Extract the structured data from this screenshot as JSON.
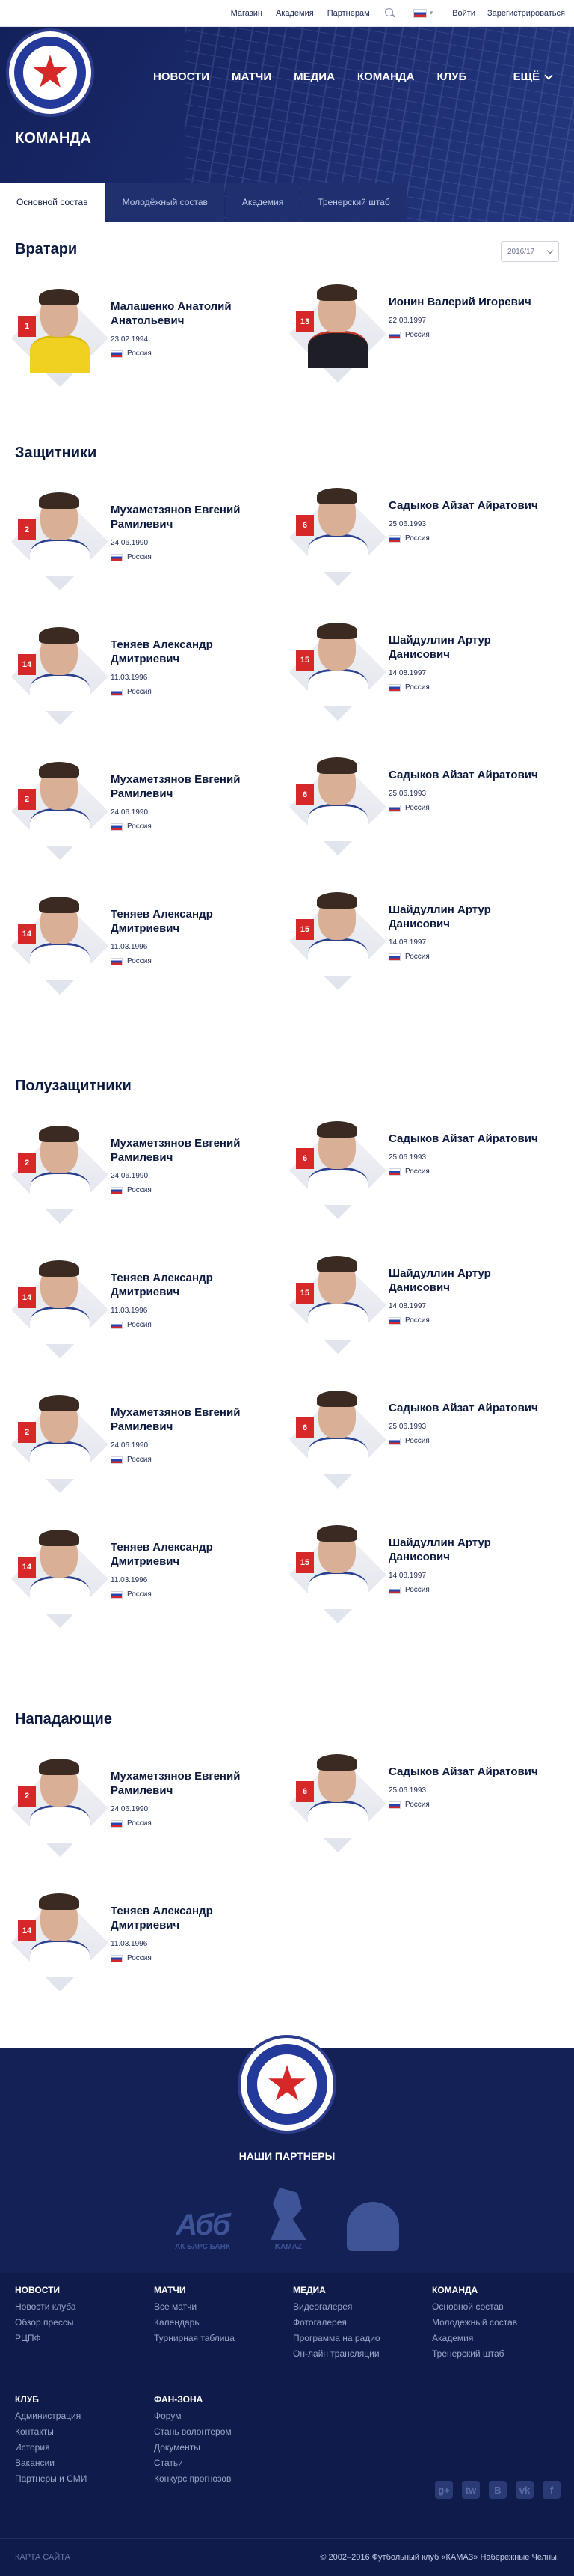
{
  "topbar": {
    "links": [
      "Магазин",
      "Академия",
      "Партнерам"
    ],
    "login": "Войти",
    "register": "Зарегистрироваться"
  },
  "nav": {
    "items": [
      "Новости",
      "Матчи",
      "Медиа",
      "Команда",
      "Клуб"
    ],
    "more": "Ещё"
  },
  "page": {
    "title": "Команда",
    "tabs": [
      "Основной состав",
      "Молодёжный состав",
      "Академия",
      "Тренерский штаб"
    ],
    "season": "2016/17"
  },
  "sections": [
    {
      "title": "Вратари",
      "players": [
        {
          "number": "1",
          "name": "Малашенко Анатолий Анатольевич",
          "birth": "23.02.1994",
          "country": "Россия",
          "kit": "gk"
        },
        {
          "number": "13",
          "name": "Ионин Валерий Игоревич",
          "birth": "22.08.1997",
          "country": "Россия",
          "kit": "dark"
        }
      ]
    },
    {
      "title": "Защитники",
      "players": [
        {
          "number": "2",
          "name": "Мухаметзянов Евгений Рамилевич",
          "birth": "24.06.1990",
          "country": "Россия",
          "kit": "home"
        },
        {
          "number": "6",
          "name": "Садыков Айзат Айратович",
          "birth": "25.06.1993",
          "country": "Россия",
          "kit": "home"
        },
        {
          "number": "14",
          "name": "Теняев Александр Дмитриевич",
          "birth": "11.03.1996",
          "country": "Россия",
          "kit": "home"
        },
        {
          "number": "15",
          "name": "Шайдуллин Артур Данисович",
          "birth": "14.08.1997",
          "country": "Россия",
          "kit": "home"
        },
        {
          "number": "2",
          "name": "Мухаметзянов Евгений Рамилевич",
          "birth": "24.06.1990",
          "country": "Россия",
          "kit": "home"
        },
        {
          "number": "6",
          "name": "Садыков Айзат Айратович",
          "birth": "25.06.1993",
          "country": "Россия",
          "kit": "home"
        },
        {
          "number": "14",
          "name": "Теняев Александр Дмитриевич",
          "birth": "11.03.1996",
          "country": "Россия",
          "kit": "home"
        },
        {
          "number": "15",
          "name": "Шайдуллин Артур Данисович",
          "birth": "14.08.1997",
          "country": "Россия",
          "kit": "home"
        }
      ]
    },
    {
      "title": "Полузащитники",
      "players": [
        {
          "number": "2",
          "name": "Мухаметзянов Евгений Рамилевич",
          "birth": "24.06.1990",
          "country": "Россия",
          "kit": "home"
        },
        {
          "number": "6",
          "name": "Садыков Айзат Айратович",
          "birth": "25.06.1993",
          "country": "Россия",
          "kit": "home"
        },
        {
          "number": "14",
          "name": "Теняев Александр Дмитриевич",
          "birth": "11.03.1996",
          "country": "Россия",
          "kit": "home"
        },
        {
          "number": "15",
          "name": "Шайдуллин Артур Данисович",
          "birth": "14.08.1997",
          "country": "Россия",
          "kit": "home"
        },
        {
          "number": "2",
          "name": "Мухаметзянов Евгений Рамилевич",
          "birth": "24.06.1990",
          "country": "Россия",
          "kit": "home"
        },
        {
          "number": "6",
          "name": "Садыков Айзат Айратович",
          "birth": "25.06.1993",
          "country": "Россия",
          "kit": "home"
        },
        {
          "number": "14",
          "name": "Теняев Александр Дмитриевич",
          "birth": "11.03.1996",
          "country": "Россия",
          "kit": "home"
        },
        {
          "number": "15",
          "name": "Шайдуллин Артур Данисович",
          "birth": "14.08.1997",
          "country": "Россия",
          "kit": "home"
        }
      ]
    },
    {
      "title": "Нападающие",
      "players": [
        {
          "number": "2",
          "name": "Мухаметзянов Евгений Рамилевич",
          "birth": "24.06.1990",
          "country": "Россия",
          "kit": "home"
        },
        {
          "number": "6",
          "name": "Садыков Айзат Айратович",
          "birth": "25.06.1993",
          "country": "Россия",
          "kit": "home"
        },
        {
          "number": "14",
          "name": "Теняев Александр Дмитриевич",
          "birth": "11.03.1996",
          "country": "Россия",
          "kit": "home"
        }
      ]
    }
  ],
  "partners": {
    "title": "Наши партнеры",
    "logos": [
      {
        "mark": "Абб",
        "caption": "АК БАРС БАНК"
      },
      {
        "mark": "",
        "caption": "KAMAZ"
      },
      {
        "mark": "",
        "caption": ""
      }
    ]
  },
  "footer": {
    "columns": [
      {
        "title": "Новости",
        "items": [
          "Новости клуба",
          "Обзор прессы",
          "РЦПФ"
        ]
      },
      {
        "title": "Матчи",
        "items": [
          "Все матчи",
          "Календарь",
          "Турнирная таблица"
        ]
      },
      {
        "title": "Медиа",
        "items": [
          "Видеогалерея",
          "Фотогалерея",
          "Программа на радио",
          "Он-лайн трансляции"
        ]
      },
      {
        "title": "Команда",
        "items": [
          "Основной состав",
          "Молодежный состав",
          "Академия",
          "Тренерский штаб"
        ]
      },
      {
        "title": "Клуб",
        "items": [
          "Администрация",
          "Контакты",
          "История",
          "Вакансии",
          "Партнеры и СМИ"
        ]
      },
      {
        "title": "Фан-зона",
        "items": [
          "Форум",
          "Стань волонтером",
          "Документы",
          "Статьи",
          "Конкурс прогнозов"
        ]
      }
    ],
    "social": [
      "g+",
      "tw",
      "B",
      "vk",
      "f"
    ],
    "sitemap": "КАРТА САЙТА",
    "copyright": "© 2002–2016 Футбольный клуб «КАМАЗ» Набережные Челны."
  }
}
